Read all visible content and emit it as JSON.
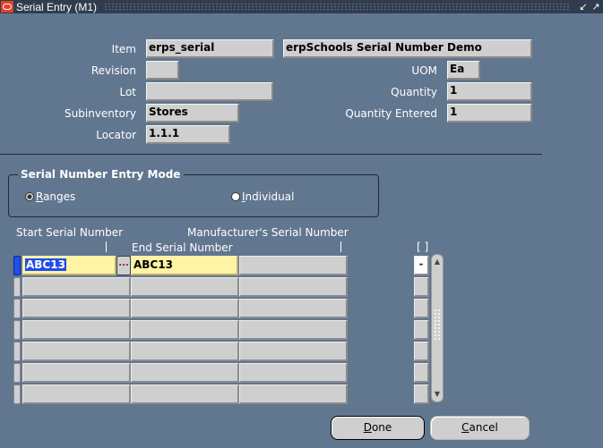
{
  "window": {
    "title": "Serial Entry (M1)",
    "minimize_icon": "minimize-icon",
    "maximize_icon": "maximize-icon"
  },
  "header": {
    "item": {
      "label": "Item",
      "value": "erps_serial",
      "description": "erpSchools Serial Number Demo"
    },
    "revision": {
      "label": "Revision",
      "value": ""
    },
    "lot": {
      "label": "Lot",
      "value": ""
    },
    "subinventory": {
      "label": "Subinventory",
      "value": "Stores"
    },
    "locator": {
      "label": "Locator",
      "value": "1.1.1"
    },
    "uom": {
      "label": "UOM",
      "value": "Ea"
    },
    "quantity": {
      "label": "Quantity",
      "value": "1"
    },
    "quantity_entered": {
      "label": "Quantity Entered",
      "value": "1"
    }
  },
  "entry_mode": {
    "title": "Serial Number Entry Mode",
    "options": [
      {
        "label": "Ranges",
        "mnemonic": "R",
        "rest": "anges",
        "selected": true
      },
      {
        "label": "Individual",
        "mnemonic": "I",
        "rest": "ndividual",
        "selected": false
      }
    ]
  },
  "table": {
    "columns": {
      "start_serial": "Start Serial Number",
      "end_serial": "End Serial Number",
      "manufacturer_serial": "Manufacturer's Serial Number",
      "select": "[ ]"
    },
    "lov_label": "...",
    "rows": [
      {
        "start": "ABC13",
        "end": "ABC13",
        "manufacturer": "",
        "select": "-"
      },
      {
        "start": "",
        "end": "",
        "manufacturer": "",
        "select": ""
      },
      {
        "start": "",
        "end": "",
        "manufacturer": "",
        "select": ""
      },
      {
        "start": "",
        "end": "",
        "manufacturer": "",
        "select": ""
      },
      {
        "start": "",
        "end": "",
        "manufacturer": "",
        "select": ""
      },
      {
        "start": "",
        "end": "",
        "manufacturer": "",
        "select": ""
      },
      {
        "start": "",
        "end": "",
        "manufacturer": "",
        "select": ""
      }
    ]
  },
  "buttons": {
    "done": {
      "label": "Done",
      "mnemonic": "D",
      "rest": "one"
    },
    "cancel": {
      "label": "Cancel",
      "mnemonic": "C",
      "rest": "ancel"
    }
  }
}
